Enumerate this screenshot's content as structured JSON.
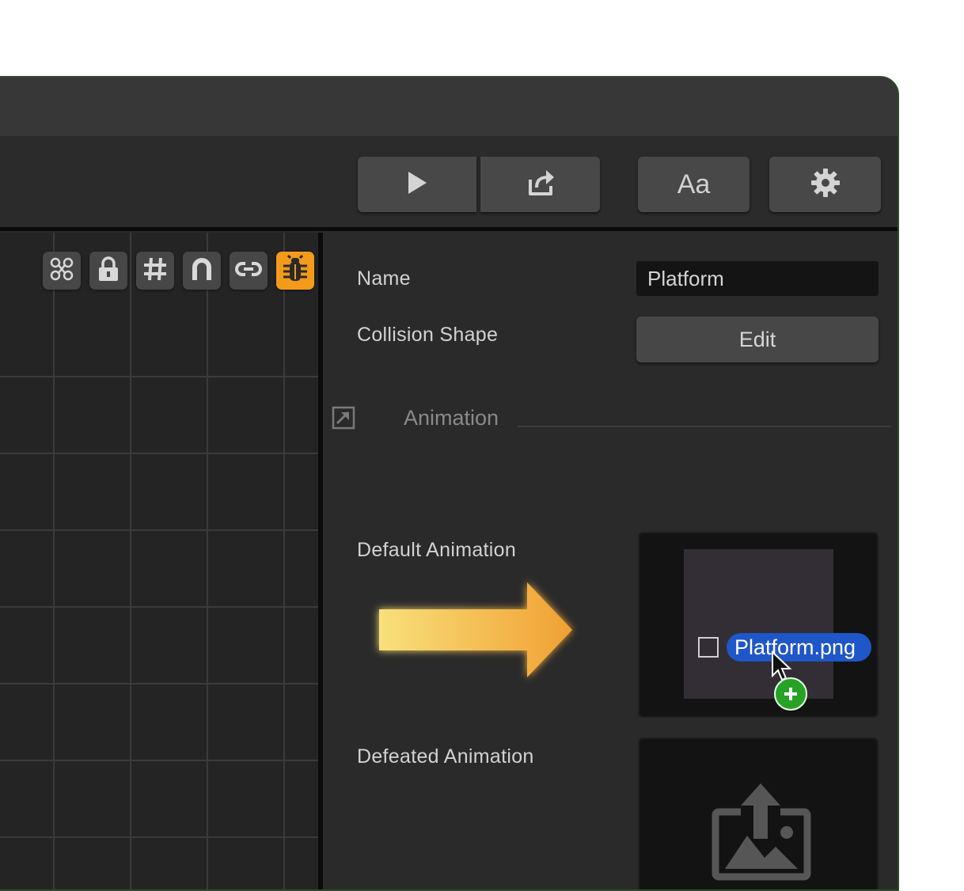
{
  "toolbar": {
    "play_icon": "play-icon",
    "share_icon": "share-icon",
    "font_label": "Aa",
    "settings_icon": "gear-icon"
  },
  "canvas_tools": [
    "nodes-icon",
    "lock-icon",
    "grid-hash-icon",
    "magnet-icon",
    "link-icon",
    "bug-icon"
  ],
  "inspector": {
    "name_label": "Name",
    "name_value": "Platform",
    "collision_label": "Collision Shape",
    "edit_label": "Edit",
    "section_title": "Animation",
    "default_anim_label": "Default Animation",
    "defeated_anim_label": "Defeated Animation",
    "drag_file_name": "Platform.png"
  },
  "colors": {
    "accent_orange": "#f39a1b",
    "drag_blue": "#1f56c8",
    "add_green": "#27a227",
    "arrow_gold": "#f5b94a"
  }
}
